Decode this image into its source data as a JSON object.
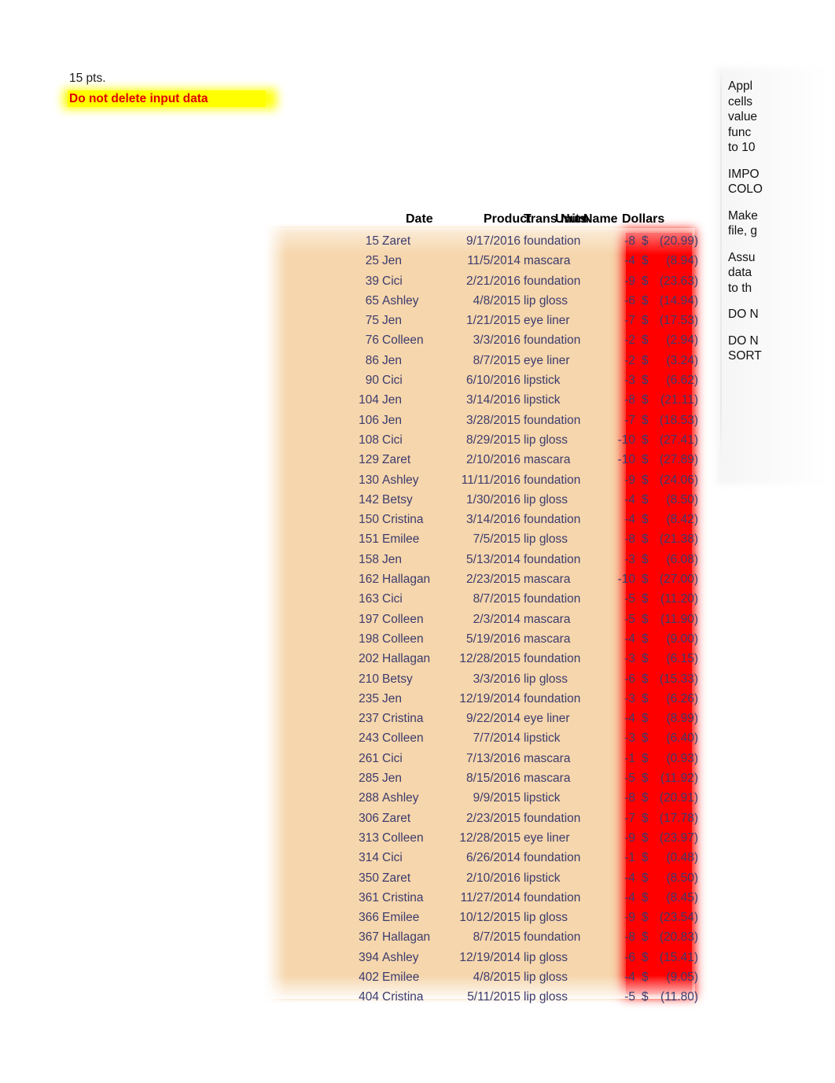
{
  "instructions": {
    "points_label": "15 pts.",
    "warning_text": "Do not delete input data",
    "warning_highlight_color": "#ffff00",
    "warning_text_color": "#e00000"
  },
  "table": {
    "headers": {
      "trans_num": "Trans Num",
      "name": "Name",
      "date": "Date",
      "product": "Product",
      "units": "Units",
      "dollars": "Dollars"
    },
    "currency_symbol": "$",
    "colors": {
      "body_fill": "#f6d6ac",
      "dollars_highlight": "#fe0000",
      "data_text": "#3c3c6e",
      "header_text": "#000000"
    },
    "rows": [
      {
        "trans_num": "15",
        "name": "Zaret",
        "date": "9/17/2016",
        "product": "foundation",
        "units": "-8",
        "amount": "(20.99)"
      },
      {
        "trans_num": "25",
        "name": "Jen",
        "date": "11/5/2014",
        "product": "mascara",
        "units": "-4",
        "amount": "(8.94)"
      },
      {
        "trans_num": "39",
        "name": "Cici",
        "date": "2/21/2016",
        "product": "foundation",
        "units": "-9",
        "amount": "(23.63)"
      },
      {
        "trans_num": "65",
        "name": "Ashley",
        "date": "4/8/2015",
        "product": "lip gloss",
        "units": "-6",
        "amount": "(14.94)"
      },
      {
        "trans_num": "75",
        "name": "Jen",
        "date": "1/21/2015",
        "product": "eye liner",
        "units": "-7",
        "amount": "(17.53)"
      },
      {
        "trans_num": "76",
        "name": "Colleen",
        "date": "3/3/2016",
        "product": "foundation",
        "units": "-2",
        "amount": "(2.94)"
      },
      {
        "trans_num": "86",
        "name": "Jen",
        "date": "8/7/2015",
        "product": "eye liner",
        "units": "-2",
        "amount": "(3.24)"
      },
      {
        "trans_num": "90",
        "name": "Cici",
        "date": "6/10/2016",
        "product": "lipstick",
        "units": "-3",
        "amount": "(6.62)"
      },
      {
        "trans_num": "104",
        "name": "Jen",
        "date": "3/14/2016",
        "product": "lipstick",
        "units": "-8",
        "amount": "(21.11)"
      },
      {
        "trans_num": "106",
        "name": "Jen",
        "date": "3/28/2015",
        "product": "foundation",
        "units": "-7",
        "amount": "(18.53)"
      },
      {
        "trans_num": "108",
        "name": "Cici",
        "date": "8/29/2015",
        "product": "lip gloss",
        "units": "-10",
        "amount": "(27.41)"
      },
      {
        "trans_num": "129",
        "name": "Zaret",
        "date": "2/10/2016",
        "product": "mascara",
        "units": "-10",
        "amount": "(27.89)"
      },
      {
        "trans_num": "130",
        "name": "Ashley",
        "date": "11/11/2016",
        "product": "foundation",
        "units": "-9",
        "amount": "(24.06)"
      },
      {
        "trans_num": "142",
        "name": "Betsy",
        "date": "1/30/2016",
        "product": "lip gloss",
        "units": "-4",
        "amount": "(8.50)"
      },
      {
        "trans_num": "150",
        "name": "Cristina",
        "date": "3/14/2016",
        "product": "foundation",
        "units": "-4",
        "amount": "(8.42)"
      },
      {
        "trans_num": "151",
        "name": "Emilee",
        "date": "7/5/2015",
        "product": "lip gloss",
        "units": "-8",
        "amount": "(21.38)"
      },
      {
        "trans_num": "158",
        "name": "Jen",
        "date": "5/13/2014",
        "product": "foundation",
        "units": "-3",
        "amount": "(6.08)"
      },
      {
        "trans_num": "162",
        "name": "Hallagan",
        "date": "2/23/2015",
        "product": "mascara",
        "units": "-10",
        "amount": "(27.00)"
      },
      {
        "trans_num": "163",
        "name": "Cici",
        "date": "8/7/2015",
        "product": "foundation",
        "units": "-5",
        "amount": "(11.20)"
      },
      {
        "trans_num": "197",
        "name": "Colleen",
        "date": "2/3/2014",
        "product": "mascara",
        "units": "-5",
        "amount": "(11.90)"
      },
      {
        "trans_num": "198",
        "name": "Colleen",
        "date": "5/19/2016",
        "product": "mascara",
        "units": "-4",
        "amount": "(9.00)"
      },
      {
        "trans_num": "202",
        "name": "Hallagan",
        "date": "12/28/2015",
        "product": "foundation",
        "units": "-3",
        "amount": "(6.15)"
      },
      {
        "trans_num": "210",
        "name": "Betsy",
        "date": "3/3/2016",
        "product": "lip gloss",
        "units": "-6",
        "amount": "(15.33)"
      },
      {
        "trans_num": "235",
        "name": "Jen",
        "date": "12/19/2014",
        "product": "foundation",
        "units": "-3",
        "amount": "(6.26)"
      },
      {
        "trans_num": "237",
        "name": "Cristina",
        "date": "9/22/2014",
        "product": "eye liner",
        "units": "-4",
        "amount": "(8.99)"
      },
      {
        "trans_num": "243",
        "name": "Colleen",
        "date": "7/7/2014",
        "product": "lipstick",
        "units": "-3",
        "amount": "(6.40)"
      },
      {
        "trans_num": "261",
        "name": "Cici",
        "date": "7/13/2016",
        "product": "mascara",
        "units": "-1",
        "amount": "(0.93)"
      },
      {
        "trans_num": "285",
        "name": "Jen",
        "date": "8/15/2016",
        "product": "mascara",
        "units": "-5",
        "amount": "(11.92)"
      },
      {
        "trans_num": "288",
        "name": "Ashley",
        "date": "9/9/2015",
        "product": "lipstick",
        "units": "-8",
        "amount": "(20.91)"
      },
      {
        "trans_num": "306",
        "name": "Zaret",
        "date": "2/23/2015",
        "product": "foundation",
        "units": "-7",
        "amount": "(17.78)"
      },
      {
        "trans_num": "313",
        "name": "Colleen",
        "date": "12/28/2015",
        "product": "eye liner",
        "units": "-9",
        "amount": "(23.97)"
      },
      {
        "trans_num": "314",
        "name": "Cici",
        "date": "6/26/2014",
        "product": "foundation",
        "units": "-1",
        "amount": "(0.48)"
      },
      {
        "trans_num": "350",
        "name": "Zaret",
        "date": "2/10/2016",
        "product": "lipstick",
        "units": "-4",
        "amount": "(8.50)"
      },
      {
        "trans_num": "361",
        "name": "Cristina",
        "date": "11/27/2014",
        "product": "foundation",
        "units": "-4",
        "amount": "(8.45)"
      },
      {
        "trans_num": "366",
        "name": "Emilee",
        "date": "10/12/2015",
        "product": "lip gloss",
        "units": "-9",
        "amount": "(23.54)"
      },
      {
        "trans_num": "367",
        "name": "Hallagan",
        "date": "8/7/2015",
        "product": "foundation",
        "units": "-8",
        "amount": "(20.83)"
      },
      {
        "trans_num": "394",
        "name": "Ashley",
        "date": "12/19/2014",
        "product": "lip gloss",
        "units": "-6",
        "amount": "(15.41)"
      },
      {
        "trans_num": "402",
        "name": "Emilee",
        "date": "4/8/2015",
        "product": "lip gloss",
        "units": "-4",
        "amount": "(9.05)"
      },
      {
        "trans_num": "404",
        "name": "Cristina",
        "date": "5/11/2015",
        "product": "lip gloss",
        "units": "-5",
        "amount": "(11.80)"
      }
    ]
  },
  "side_panel": {
    "paragraphs": [
      {
        "lines": "Appl\ncells\nvalue\nfunc\nto 10"
      },
      {
        "lines": "IMPO\nCOLO"
      },
      {
        "lines": "Make\nfile, g"
      },
      {
        "lines": "Assu\ndata\nto th"
      },
      {
        "lines": "DO N"
      },
      {
        "lines": "DO N\nSORT"
      }
    ]
  }
}
